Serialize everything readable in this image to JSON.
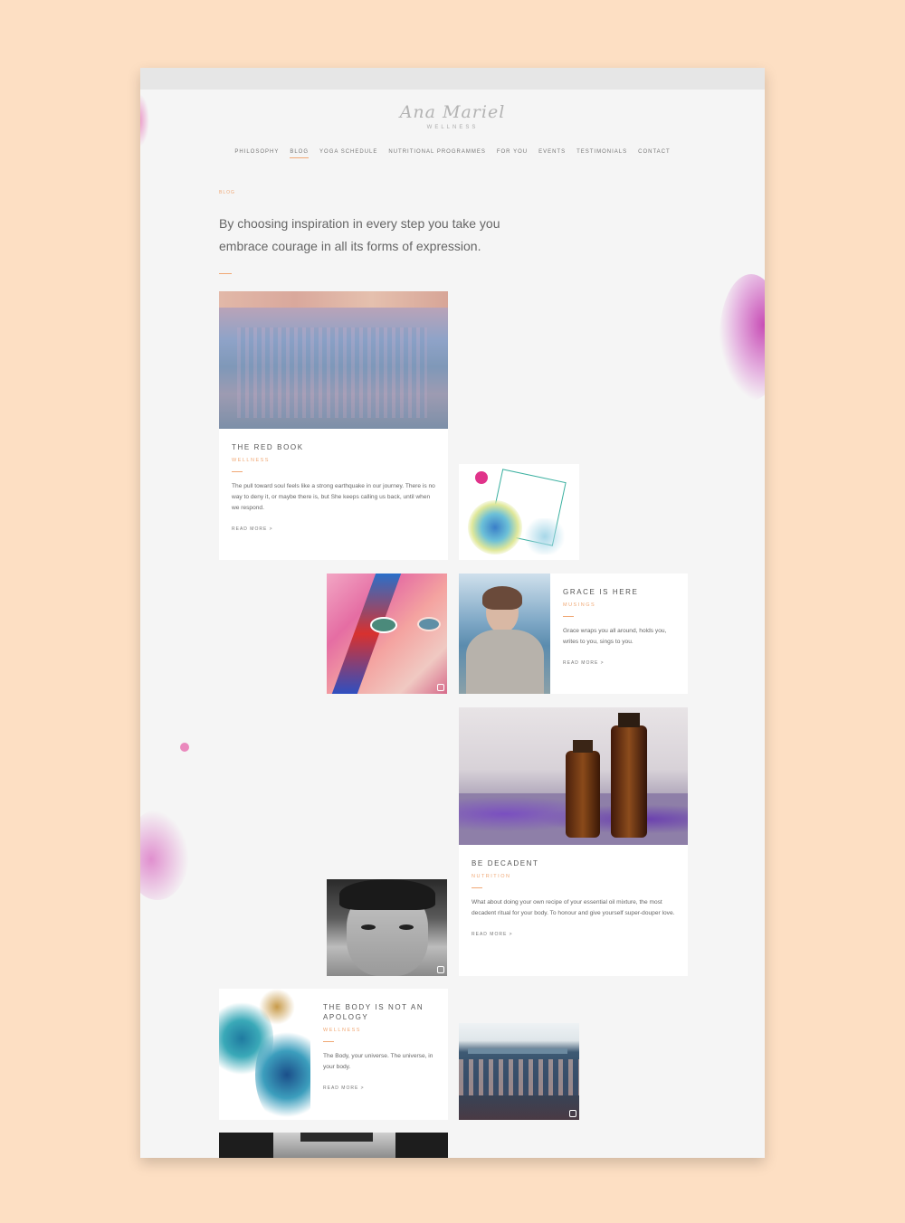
{
  "site": {
    "logo_script": "Ana Mariel",
    "logo_sub": "WELLNESS"
  },
  "nav": {
    "items": [
      {
        "label": "PHILOSOPHY"
      },
      {
        "label": "BLOG"
      },
      {
        "label": "YOGA SCHEDULE"
      },
      {
        "label": "NUTRITIONAL PROGRAMMES"
      },
      {
        "label": "FOR YOU"
      },
      {
        "label": "EVENTS"
      },
      {
        "label": "TESTIMONIALS"
      },
      {
        "label": "CONTACT"
      }
    ],
    "active": "BLOG"
  },
  "page": {
    "eyebrow": "BLOG",
    "hero": "By choosing inspiration in every step you take you embrace courage in all its forms of expression."
  },
  "posts": [
    {
      "title": "THE RED BOOK",
      "category": "WELLNESS",
      "excerpt": "The pull toward soul feels like a strong earthquake in our journey. There is no way to deny it, or maybe there is, but She keeps calling us back, until when we respond.",
      "more": "READ MORE >"
    },
    {
      "title": "GRACE IS HERE",
      "category": "MUSINGS",
      "excerpt": "Grace wraps you all around, holds you, writes to you, sings to you.",
      "more": "READ MORE >"
    },
    {
      "title": "BE DECADENT",
      "category": "NUTRITION",
      "excerpt": "What about doing your own recipe of your essential oil mixture, the most decadent ritual for your body. To honour and give yourself super-douper love.",
      "more": "READ MORE >"
    },
    {
      "title": "THE BODY IS NOT AN APOLOGY",
      "category": "WELLNESS",
      "excerpt": "The Body, your universe. The universe, in your body.",
      "more": "READ MORE >"
    }
  ],
  "colors": {
    "background": "#fddfc3",
    "page": "#f5f5f5",
    "accent": "#f0a875",
    "splash": "#c94fb0"
  },
  "icons": {
    "instagram": "instagram-icon"
  }
}
